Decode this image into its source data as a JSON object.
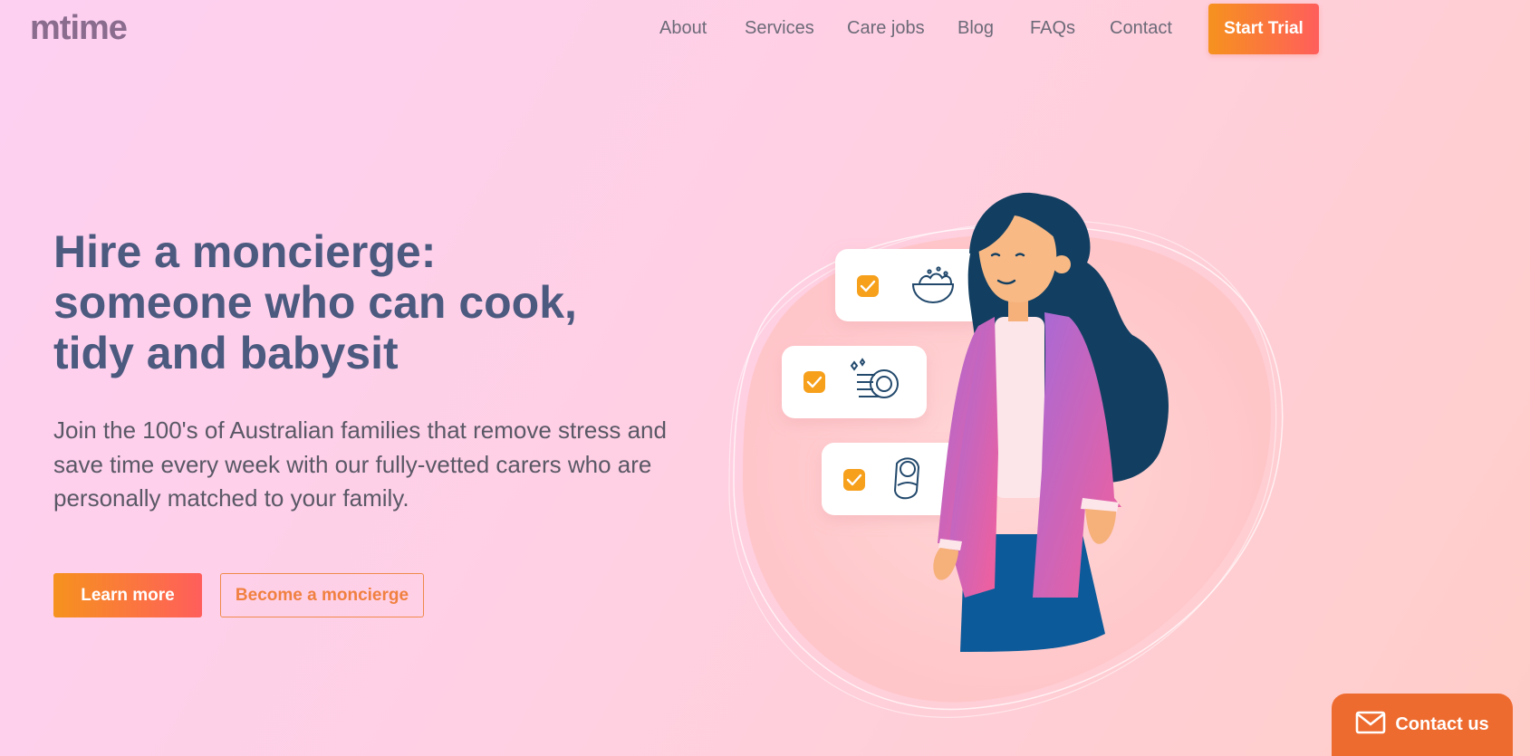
{
  "brand": {
    "logo": "mtime",
    "accent_start": "#f6921e",
    "accent_end": "#ff5e5b",
    "text_color": "#4c5a80"
  },
  "nav": {
    "items": [
      {
        "label": "About"
      },
      {
        "label": "Services"
      },
      {
        "label": "Care jobs"
      },
      {
        "label": "Blog"
      },
      {
        "label": "FAQs"
      },
      {
        "label": "Contact"
      }
    ],
    "cta": "Start Trial"
  },
  "hero": {
    "title_lines": [
      "Hire a moncierge:",
      "someone who can cook,",
      "tidy and babysit"
    ],
    "subtitle": "Join the 100's of Australian families that remove stress and save time every week with our fully-vetted carers who are personally matched to your family.",
    "primary_button": "Learn more",
    "secondary_button": "Become a moncierge"
  },
  "illustration": {
    "tasks": [
      {
        "icon": "food-bowl-icon",
        "checked": true
      },
      {
        "icon": "clean-dishes-icon",
        "checked": true
      },
      {
        "icon": "baby-icon",
        "checked": true
      }
    ]
  },
  "contact_widget": {
    "label": "Contact us",
    "icon": "mail-icon"
  }
}
